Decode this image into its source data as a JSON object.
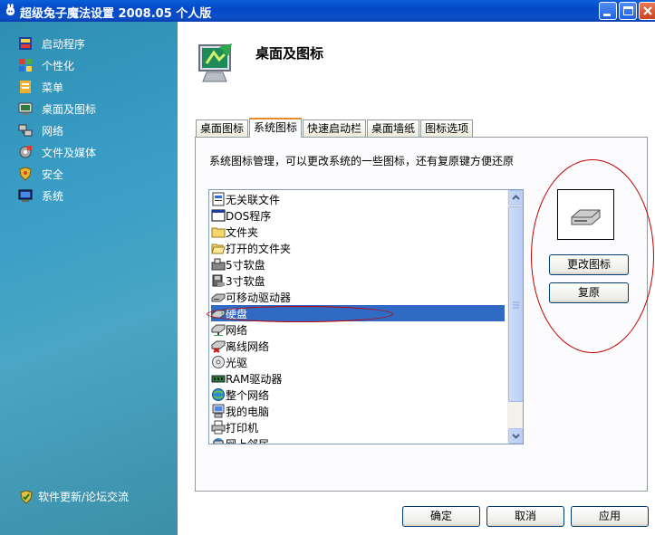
{
  "window": {
    "title": "超级兔子魔法设置 2008.05 个人版"
  },
  "sidebar": {
    "items": [
      {
        "label": "启动程序",
        "icon": "startup-icon"
      },
      {
        "label": "个性化",
        "icon": "personalize-icon"
      },
      {
        "label": "菜单",
        "icon": "menu-icon"
      },
      {
        "label": "桌面及图标",
        "icon": "desktop-icon"
      },
      {
        "label": "网络",
        "icon": "network-icon"
      },
      {
        "label": "文件及媒体",
        "icon": "media-icon"
      },
      {
        "label": "安全",
        "icon": "security-icon"
      },
      {
        "label": "系统",
        "icon": "system-icon"
      }
    ],
    "update_link": "软件更新/论坛交流"
  },
  "page": {
    "title": "桌面及图标"
  },
  "tabs": [
    {
      "label": "桌面图标",
      "active": false
    },
    {
      "label": "系统图标",
      "active": true
    },
    {
      "label": "快速启动栏",
      "active": false
    },
    {
      "label": "桌面墙纸",
      "active": false
    },
    {
      "label": "图标选项",
      "active": false
    }
  ],
  "panel": {
    "description": "系统图标管理，可以更改系统的一些图标，还有复原键方便还原",
    "list_items": [
      {
        "label": "无关联文件",
        "icon": "unknown-file-icon"
      },
      {
        "label": "DOS程序",
        "icon": "dos-program-icon"
      },
      {
        "label": "文件夹",
        "icon": "folder-icon"
      },
      {
        "label": "打开的文件夹",
        "icon": "open-folder-icon"
      },
      {
        "label": "5寸软盘",
        "icon": "floppy-5-icon"
      },
      {
        "label": "3寸软盘",
        "icon": "floppy-3-icon"
      },
      {
        "label": "可移动驱动器",
        "icon": "removable-drive-icon"
      },
      {
        "label": "硬盘",
        "icon": "hard-disk-icon",
        "selected": true
      },
      {
        "label": "网络",
        "icon": "network-drive-icon"
      },
      {
        "label": "离线网络",
        "icon": "offline-network-icon"
      },
      {
        "label": "光驱",
        "icon": "cdrom-icon"
      },
      {
        "label": "RAM驱动器",
        "icon": "ram-drive-icon"
      },
      {
        "label": "整个网络",
        "icon": "entire-network-icon"
      },
      {
        "label": "我的电脑",
        "icon": "my-computer-icon"
      },
      {
        "label": "打印机",
        "icon": "printer-icon"
      },
      {
        "label": "网上邻居",
        "icon": "network-places-icon"
      }
    ],
    "change_icon_label": "更改图标",
    "restore_label": "复原"
  },
  "footer": {
    "ok_label": "确定",
    "cancel_label": "取消",
    "apply_label": "应用"
  },
  "colors": {
    "selection": "#316ac5",
    "annotation": "#c00000",
    "titlebar": "#0548c7"
  }
}
